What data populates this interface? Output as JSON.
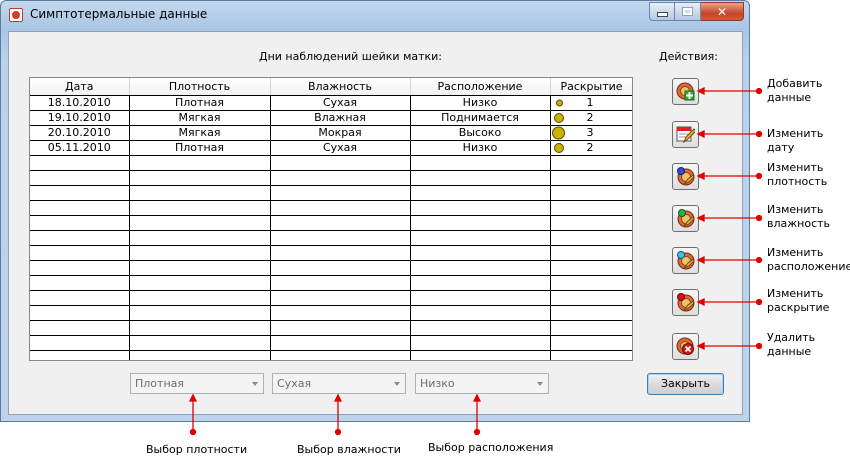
{
  "window": {
    "title": "Симптотермальные данные"
  },
  "headings": {
    "table": "Дни наблюдений шейки матки:",
    "actions": "Действия:"
  },
  "table": {
    "columns": [
      "Дата",
      "Плотность",
      "Влажность",
      "Расположение",
      "Раскрытие"
    ],
    "rows": [
      {
        "date": "18.10.2010",
        "density": "Плотная",
        "moisture": "Сухая",
        "position": "Низко",
        "opening": "1"
      },
      {
        "date": "19.10.2010",
        "density": "Мягкая",
        "moisture": "Влажная",
        "position": "Поднимается",
        "opening": "2"
      },
      {
        "date": "20.10.2010",
        "density": "Мягкая",
        "moisture": "Мокрая",
        "position": "Высоко",
        "opening": "3"
      },
      {
        "date": "05.11.2010",
        "density": "Плотная",
        "moisture": "Сухая",
        "position": "Низко",
        "opening": "2"
      }
    ]
  },
  "selectors": {
    "density_value": "Плотная",
    "moisture_value": "Сухая",
    "position_value": "Низко"
  },
  "buttons": {
    "close_label": "Закрыть"
  },
  "callouts": {
    "add": [
      "Добавить",
      "данные"
    ],
    "edit_date": [
      "Изменить дату"
    ],
    "edit_density": [
      "Изменить",
      "плотность"
    ],
    "edit_moisture": [
      "Изменить",
      "влажность"
    ],
    "edit_position": [
      "Изменить",
      "расположение"
    ],
    "edit_opening": [
      "Изменить",
      "раскрытие"
    ],
    "delete": [
      "Удалить",
      "данные"
    ],
    "density_selector": "Выбор плотности",
    "moisture_selector": "Выбор влажности",
    "position_selector": "Выбор расположения"
  },
  "colors": {
    "accent_red": "#e00000",
    "opening_dot": "#c8b400"
  },
  "icons": {
    "add": "add-data-icon",
    "edit_date": "calendar-pencil-icon",
    "edit_density": "density-badge-icon",
    "edit_moisture": "moisture-badge-icon",
    "edit_position": "position-badge-icon",
    "edit_opening": "opening-badge-icon",
    "delete": "delete-data-icon"
  }
}
